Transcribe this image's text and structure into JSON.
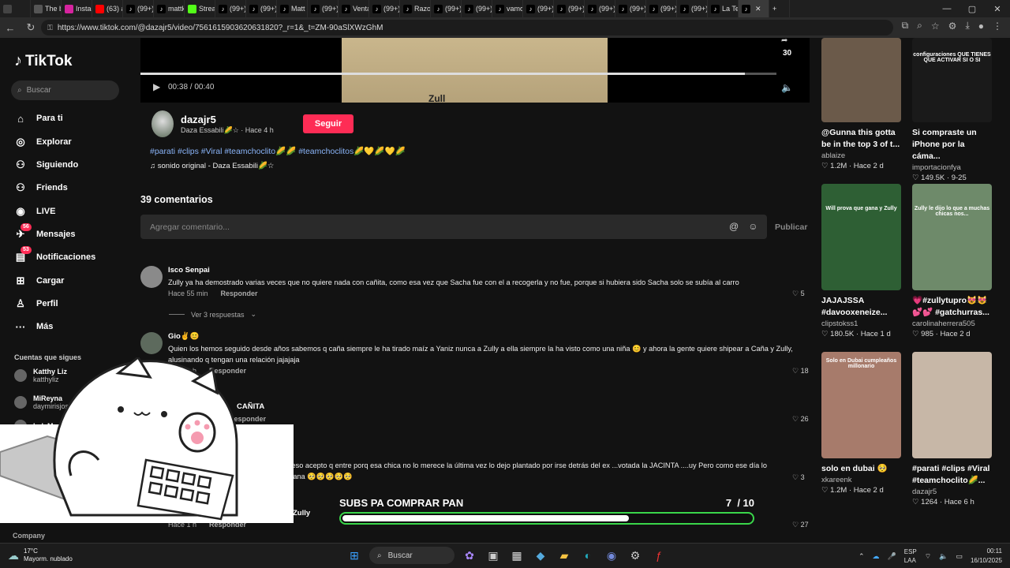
{
  "browser": {
    "tabs": [
      {
        "label": "",
        "color": "#444444"
      },
      {
        "label": "The b",
        "color": "#555555"
      },
      {
        "label": "Instag",
        "color": "#d6249f"
      },
      {
        "label": "(63) a",
        "color": "#ff0000"
      },
      {
        "label": "(99+)",
        "color": "#000000"
      },
      {
        "label": "mattk",
        "color": "#000000"
      },
      {
        "label": "Strean",
        "color": "#53fc18"
      },
      {
        "label": "(99+)",
        "color": "#000000"
      },
      {
        "label": "(99+)",
        "color": "#000000"
      },
      {
        "label": "Matt K",
        "color": "#000000"
      },
      {
        "label": "(99+)",
        "color": "#000000"
      },
      {
        "label": "Venta",
        "color": "#000000"
      },
      {
        "label": "(99+)",
        "color": "#000000"
      },
      {
        "label": "Razon",
        "color": "#000000"
      },
      {
        "label": "(99+)",
        "color": "#000000"
      },
      {
        "label": "(99+)",
        "color": "#000000"
      },
      {
        "label": "vamos",
        "color": "#000000"
      },
      {
        "label": "(99+)",
        "color": "#000000"
      },
      {
        "label": "(99+)",
        "color": "#000000"
      },
      {
        "label": "(99+)",
        "color": "#000000"
      },
      {
        "label": "(99+)",
        "color": "#000000"
      },
      {
        "label": "(99+)",
        "color": "#000000"
      },
      {
        "label": "(99+)",
        "color": "#000000"
      },
      {
        "label": "La Tec",
        "color": "#000000"
      },
      {
        "label": "",
        "color": "#000000",
        "active": true
      }
    ],
    "new_tab": "+",
    "url": "https://www.tiktok.com/@dazajr5/video/7561615903620631820?_r=1&_t=ZM-90aSlXWzGhM"
  },
  "sidebar": {
    "logo": "TikTok",
    "search_placeholder": "Buscar",
    "nav": [
      {
        "label": "Para ti",
        "icon": "home-icon",
        "glyph": "⌂"
      },
      {
        "label": "Explorar",
        "icon": "compass-icon",
        "glyph": "◎"
      },
      {
        "label": "Siguiendo",
        "icon": "following-icon",
        "glyph": "⚇"
      },
      {
        "label": "Friends",
        "icon": "friends-icon",
        "glyph": "⚇"
      },
      {
        "label": "LIVE",
        "icon": "live-icon",
        "glyph": "◉"
      },
      {
        "label": "Mensajes",
        "icon": "messages-icon",
        "glyph": "✈",
        "badge": "56"
      },
      {
        "label": "Notificaciones",
        "icon": "notifications-icon",
        "glyph": "▤",
        "badge": "53"
      },
      {
        "label": "Cargar",
        "icon": "upload-icon",
        "glyph": "⊞"
      },
      {
        "label": "Perfil",
        "icon": "profile-icon",
        "glyph": "♙"
      },
      {
        "label": "Más",
        "icon": "more-icon",
        "glyph": "···"
      }
    ],
    "following_title": "Cuentas que sigues",
    "following": [
      {
        "name": "Katthy Liz",
        "handle": "katthyliz"
      },
      {
        "name": "MiReyna",
        "handle": "daymirisjos"
      },
      {
        "name": "ladyMarly",
        "handle": ""
      }
    ],
    "company": "Company"
  },
  "video": {
    "time": "00:38 / 00:40",
    "count": "30"
  },
  "author": {
    "name": "dazajr5",
    "subtitle": "Daza Essabili🌽☆ · Hace 4 h",
    "follow": "Seguir",
    "hashtags": "#parati #clips #Viral #teamchoclito🌽🌽 #teamchoclitos🌽💛🌽💛🌽",
    "sound": "♫ sonido original - Daza Essabili🌽☆"
  },
  "comments": {
    "title": "39 comentarios",
    "placeholder": "Agregar comentario...",
    "publish": "Publicar",
    "view_replies": "Ver 3 respuestas",
    "items": [
      {
        "name": "Isco Senpai",
        "text": "Zully ya ha demostrado varias veces que no quiere nada con cañita, como esa vez que Sacha fue con el a recogerla y no fue, porque si hubiera sido Sacha solo se subía al carro",
        "time": "Hace 55 min",
        "reply": "Responder",
        "likes": "5"
      },
      {
        "name": "Gio✌️😊",
        "text": "Quien los hemos seguido desde años sabemos q caña siempre le ha tirado maíz a Yaniz nunca a Zully a ella siempre la ha visto como una niña 😊 y ahora la gente quiere shipear a Caña y Zully, alusinando q tengan una relación jajajaja",
        "time": "Hace 1 h",
        "reply": "Responder",
        "likes": "18"
      },
      {
        "name": "CAÑITA",
        "text": "",
        "time": "",
        "reply": "Responder",
        "likes": "26"
      },
      {
        "name": "",
        "text": "ro y educado por eso acepto q entre porq esa chica no lo merece la última vez lo dejo plantado por irse detrás del ex ...votada la JACINTA ....uy Pero como ese día lo",
        "text2": "fue con la hermana 🥺🥺🥺🥺🥺",
        "time": "",
        "reply": "",
        "likes": "3"
      },
      {
        "name": "Zully",
        "text": "",
        "time": "Hace 1 h",
        "reply": "Responder",
        "likes": "27"
      }
    ]
  },
  "recommendations": [
    {
      "title": "@Gunna this gotta be in the top 3 of t...",
      "user": "ablaize",
      "stats": "♡ 1.2M · Hace 2 d",
      "bg": "#6b5a4a"
    },
    {
      "title": "Si compraste un iPhone por la cáma...",
      "user": "importacionfya",
      "stats": "♡ 149.5K · 9-25",
      "bg": "#1a1a1a",
      "overlay": "configuraciones QUE TIENES QUE ACTIVAR SI O SI"
    },
    {
      "title": "JAJAJSSA #davooxeneize...",
      "user": "clipstokss1",
      "stats": "♡ 180.5K · Hace 1 d",
      "bg": "#2e5f34",
      "overlay": "Will prova que gana y Zully"
    },
    {
      "title": "💗#zullytupro😻😻💕💕 #gatchurras...",
      "user": "carolinaherrera505",
      "stats": "♡ 985 · Hace 2 d",
      "bg": "#6e8a6a",
      "overlay": "Zully le dijo lo que a muchas chicas nos..."
    },
    {
      "title": "solo en dubai 🥺",
      "user": "xkareenk",
      "stats": "♡ 1.2M · Hace 2 d",
      "bg": "#a77b6b",
      "overlay": "Solo en Dubai cumpleaños millonario"
    },
    {
      "title": "#parati #clips #Viral #teamchoclito🌽...",
      "user": "dazajr5",
      "stats": "♡ 1264 · Hace 6 h",
      "bg": "#c7b7a7"
    }
  ],
  "subs_bar": {
    "label": "SUBS PA COMPRAR PAN",
    "current": "7",
    "goal": "/ 10",
    "fraction": 0.7
  },
  "taskbar": {
    "temp": "17°C",
    "weather": "Mayorm. nublado",
    "search": "Buscar",
    "lang1": "ESP",
    "lang2": "LAA",
    "time": "00:11",
    "date": "16/10/2025"
  }
}
